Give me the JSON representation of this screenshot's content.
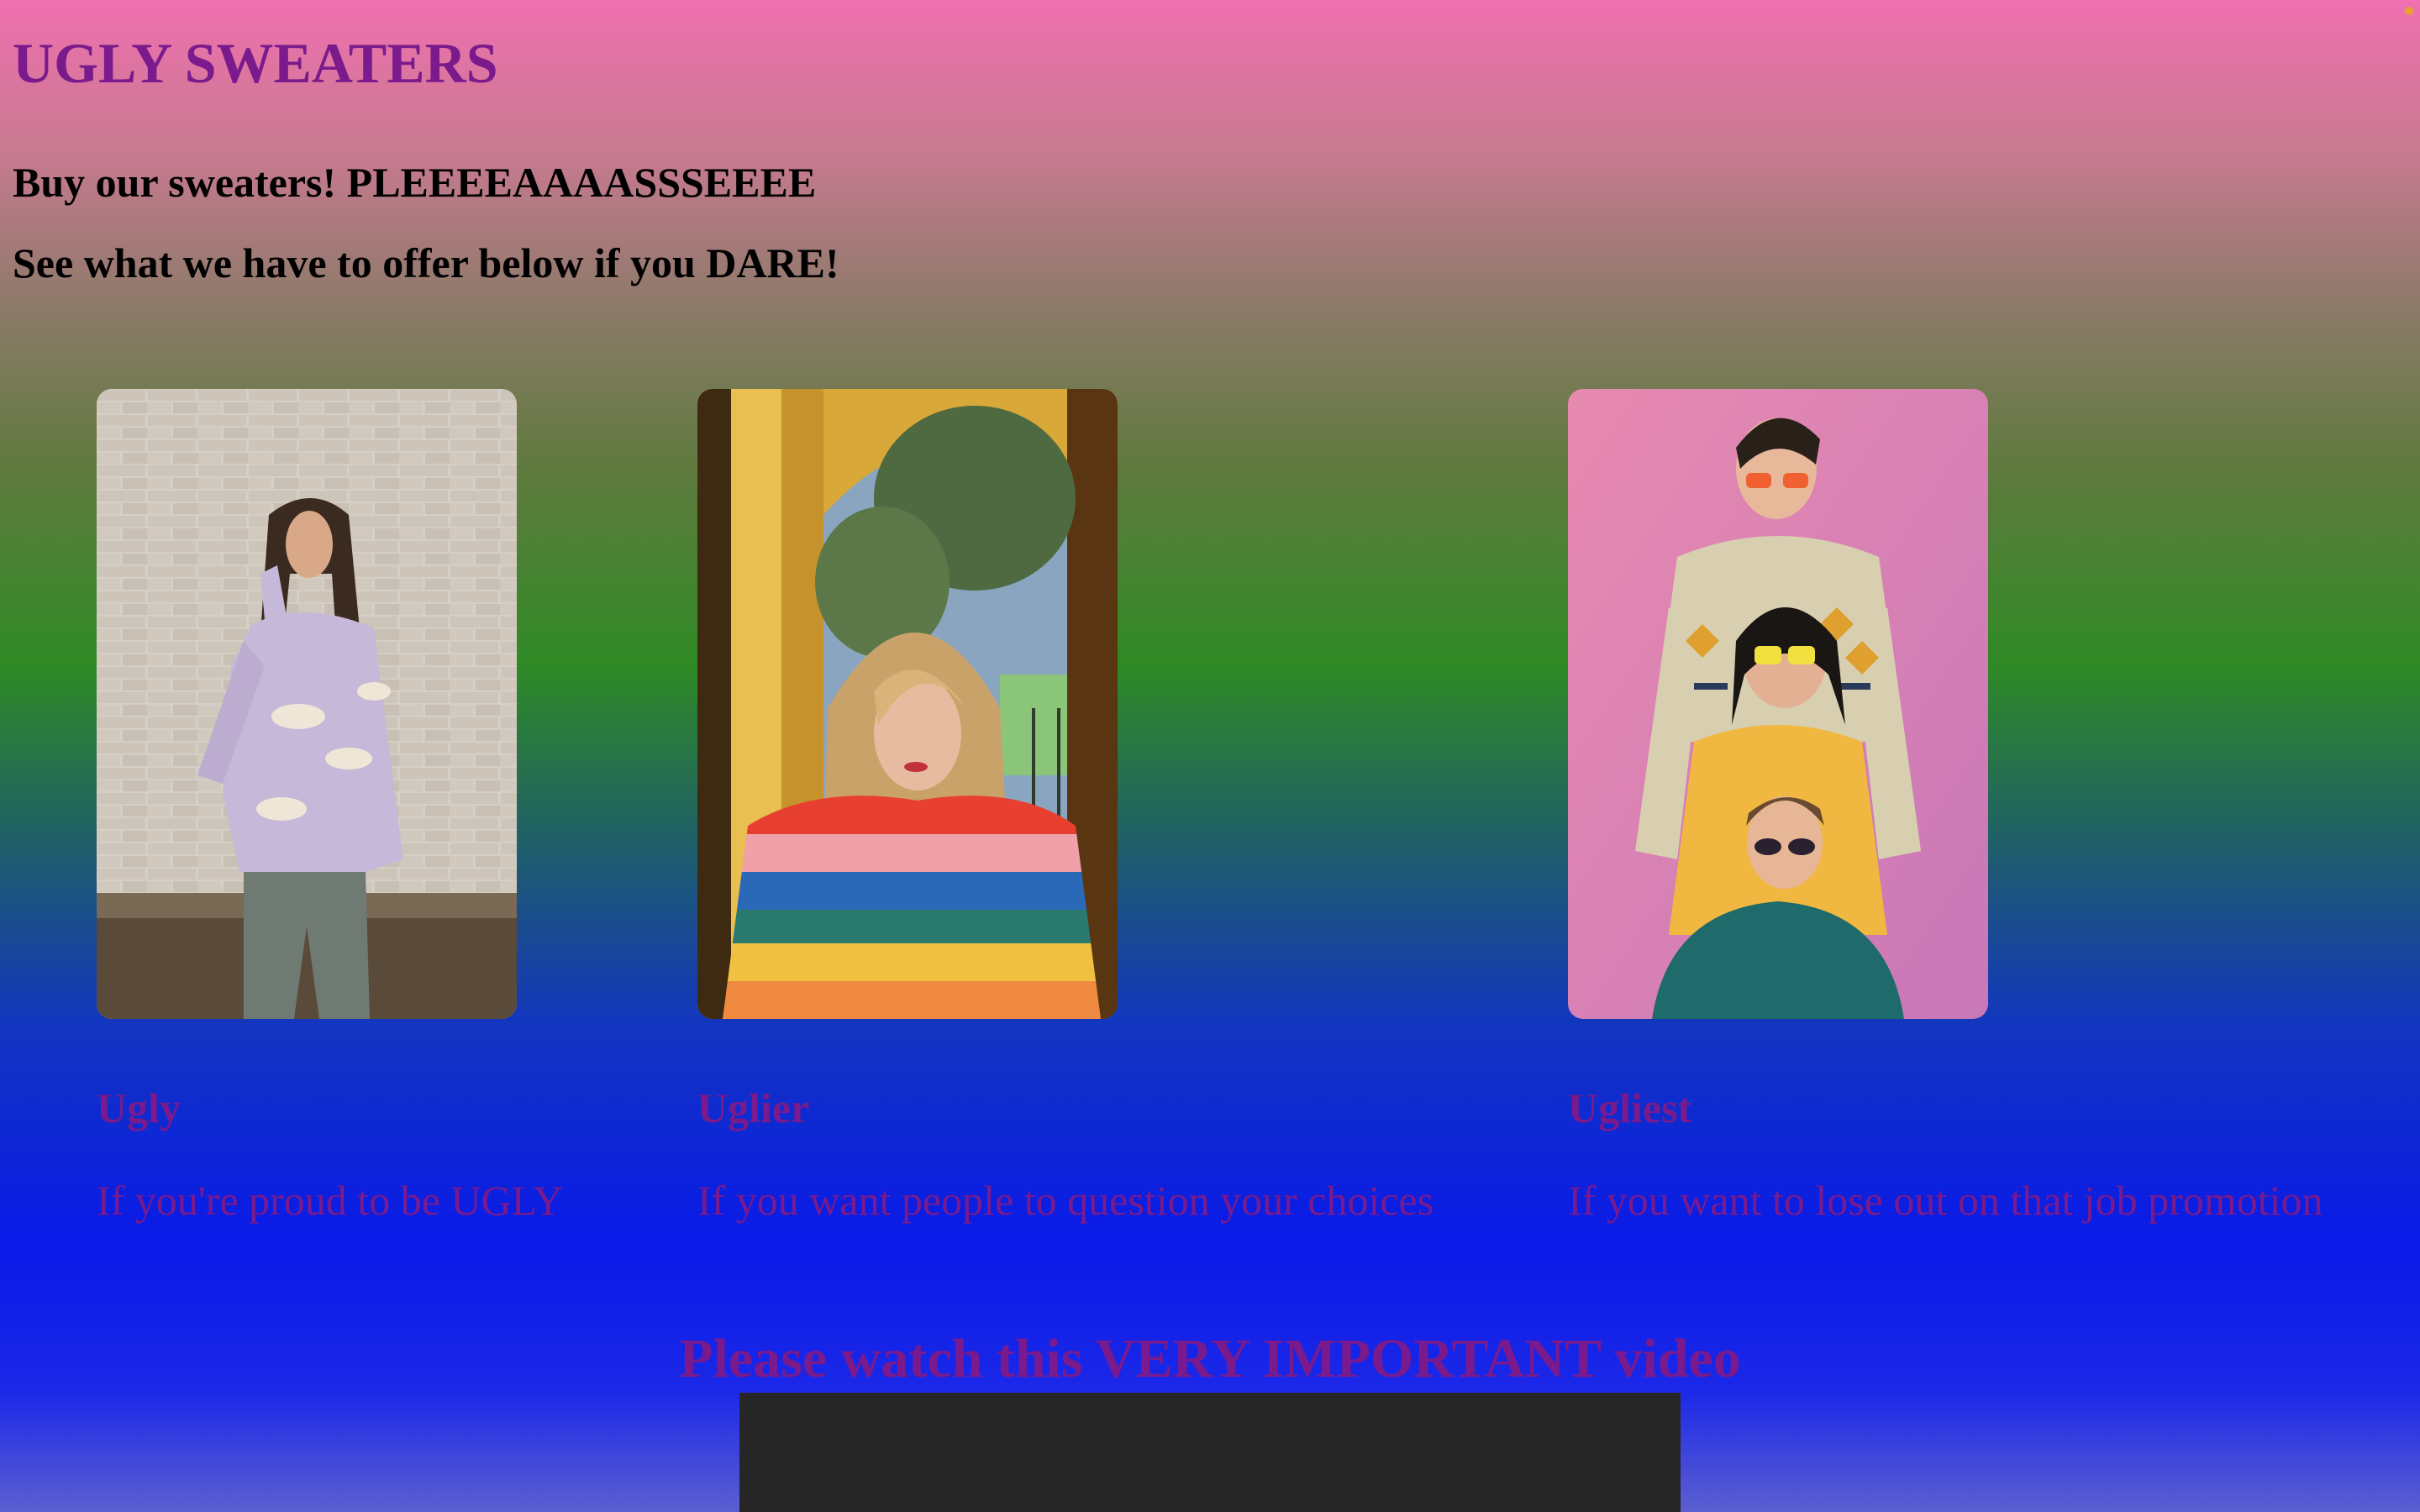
{
  "header": {
    "title": "UGLY SWEATERS",
    "tagline_1": "Buy our sweaters! PLEEEEAAAASSSEEEE",
    "tagline_2": "See what we have to offer below if you DARE!"
  },
  "products": [
    {
      "title": "Ugly",
      "description": "If you're proud to be UGLY",
      "image": "person-in-lavender-cloud-sweater-photo"
    },
    {
      "title": "Uglier",
      "description": "If you want people to question your choices",
      "image": "woman-in-rainbow-striped-sweater-photo"
    },
    {
      "title": "Ugliest",
      "description": "If you want to lose out on that job promotion",
      "image": "three-people-in-patterned-sweaters-photo"
    }
  ],
  "video": {
    "heading": "Please watch this VERY IMPORTANT video"
  },
  "colors": {
    "heading_purple": "#7a1a8c",
    "gradient_top": "#f070b0",
    "gradient_mid": "#2f8a25",
    "gradient_bottom": "#0a1ae8",
    "video_bg": "#262626"
  }
}
